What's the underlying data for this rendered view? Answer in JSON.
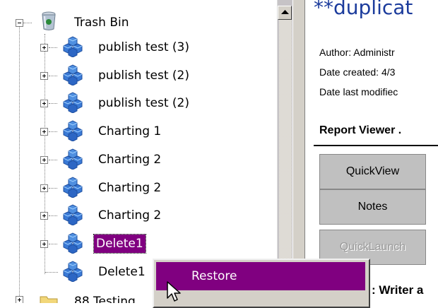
{
  "tree": {
    "root": {
      "label": "Trash Bin",
      "icon": "trash-bin-icon"
    },
    "items": [
      {
        "label": "publish test (3)",
        "icon": "report-cubes-icon",
        "expandable": true,
        "selected": false
      },
      {
        "label": "publish test (2)",
        "icon": "report-cubes-icon",
        "expandable": true,
        "selected": false
      },
      {
        "label": "publish test (2)",
        "icon": "report-cubes-icon",
        "expandable": true,
        "selected": false
      },
      {
        "label": "Charting 1",
        "icon": "report-cubes-icon",
        "expandable": true,
        "selected": false
      },
      {
        "label": "Charting 2",
        "icon": "report-cubes-icon",
        "expandable": true,
        "selected": false
      },
      {
        "label": "Charting 2",
        "icon": "report-cubes-icon",
        "expandable": true,
        "selected": false
      },
      {
        "label": "Charting 2",
        "icon": "report-cubes-icon",
        "expandable": true,
        "selected": false
      },
      {
        "label": "Delete1",
        "icon": "report-cubes-icon",
        "expandable": true,
        "selected": true
      },
      {
        "label": "Delete1",
        "icon": "report-cubes-icon",
        "expandable": false,
        "selected": false
      }
    ],
    "partial_item": {
      "label": "88 Testing",
      "icon": "folder-icon"
    }
  },
  "report": {
    "title": "**duplicat",
    "author": "Author: Administr",
    "date_created": "Date created: 4/3",
    "date_modified": "Date last modifiec",
    "viewer_heading": "Report Viewer .",
    "writer_label": ": Writer a"
  },
  "buttons": {
    "quickview": "QuickView",
    "notes": "Notes",
    "quicklaunch": "QuickLaunch"
  },
  "context_menu": {
    "items": [
      "Restore"
    ]
  },
  "colors": {
    "selection": "#800080",
    "title_blue": "#1b3b9c",
    "button_face": "#c0c0c0"
  }
}
